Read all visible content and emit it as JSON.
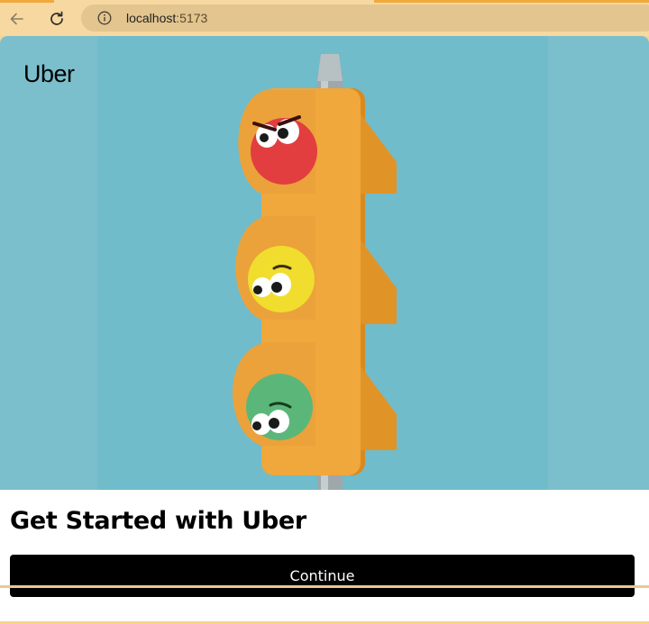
{
  "browser": {
    "url_host": "localhost",
    "url_port": ":5173"
  },
  "app": {
    "logo": "Uber",
    "hero_image": "traffic-light-illustration",
    "heading": "Get Started with Uber",
    "cta_label": "Continue"
  },
  "colors": {
    "cta_bg": "#000000",
    "cta_text": "#ffffff",
    "hero_bg": "#7bbfcc",
    "chrome_bg": "#f6d8a0"
  }
}
